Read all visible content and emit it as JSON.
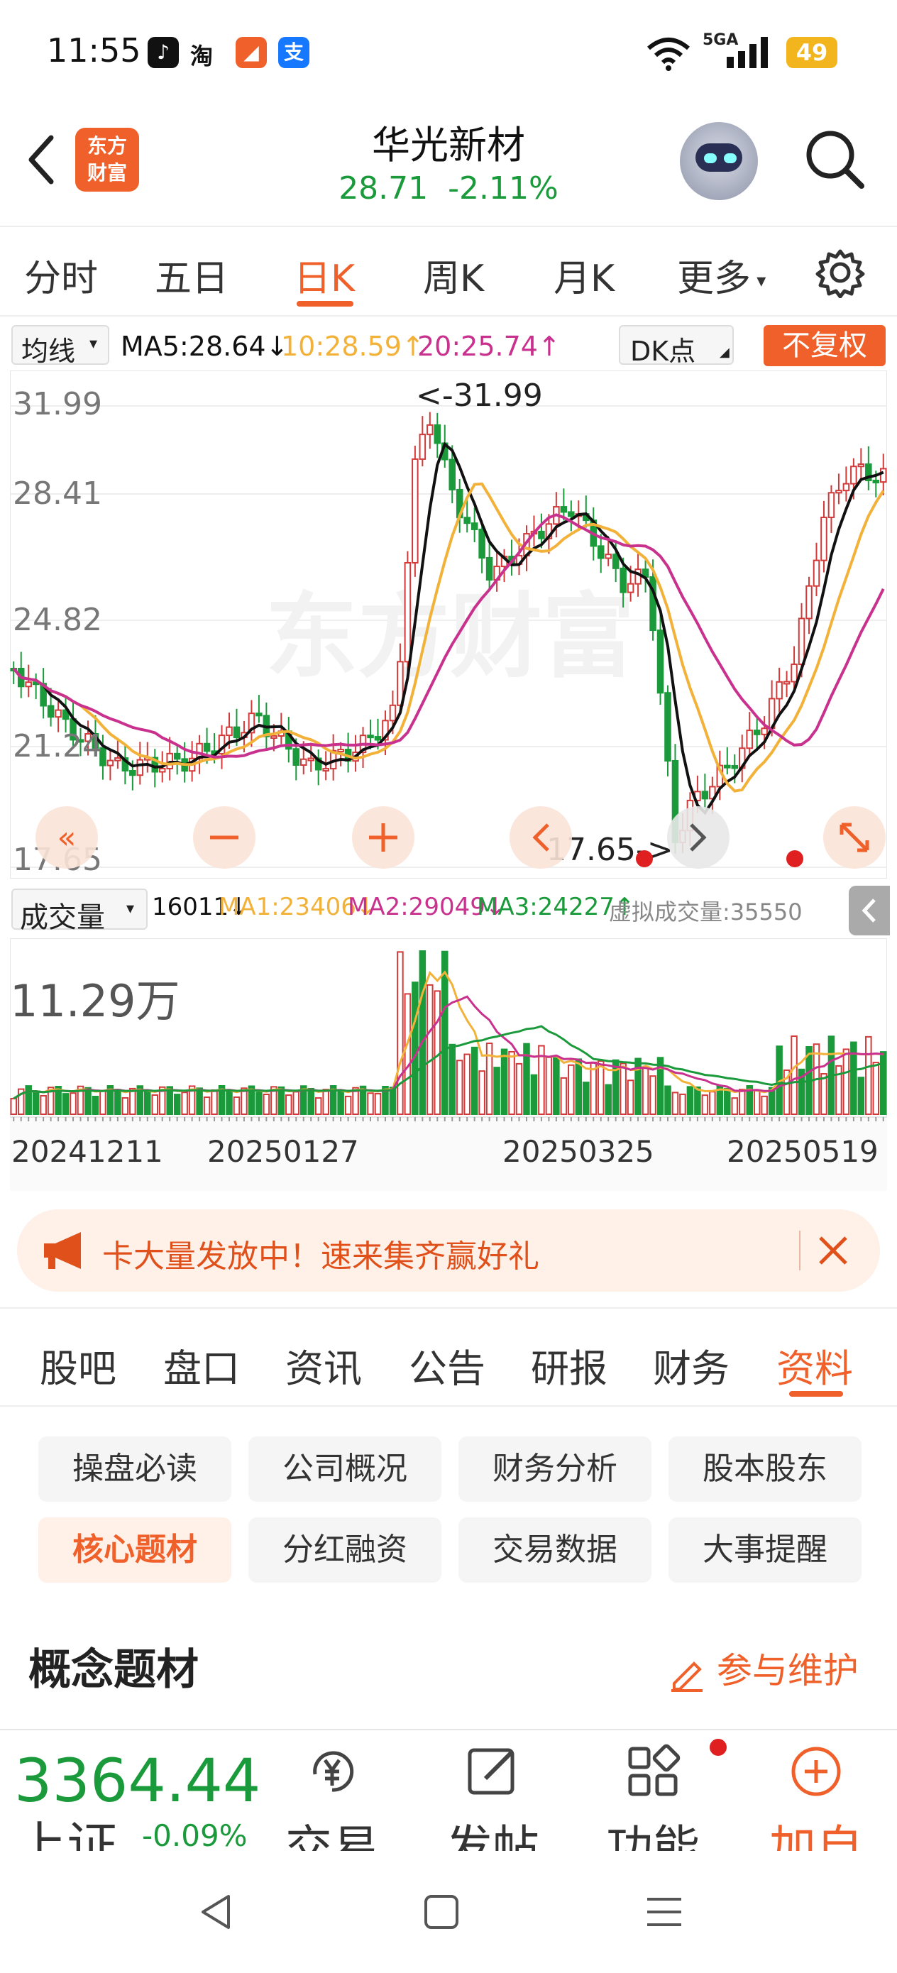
{
  "status_bar": {
    "time": "11:55",
    "battery": "49",
    "network": "5GA",
    "apps": [
      "淘"
    ]
  },
  "header": {
    "logo_text": "东方\n财富",
    "stock_name": "华光新材",
    "price": "28.71",
    "change": "-2.11%"
  },
  "period_tabs": {
    "items": [
      "分时",
      "五日",
      "日K",
      "周K",
      "月K",
      "更多"
    ],
    "active": "日K"
  },
  "ma_line": {
    "selector": "均线",
    "ma5": "MA5:28.64↓",
    "ma10": "10:28.59↑",
    "ma20": "20:25.74↑",
    "dk": "DK点",
    "fuquan": "不复权"
  },
  "colors": {
    "accent": "#f0602a",
    "up": "#d23a3a",
    "down": "#1a9a3a",
    "ma5": "#111111",
    "ma10": "#f2b23a",
    "ma20": "#c8328e"
  },
  "kline": {
    "y_labels": [
      "31.99",
      "28.41",
      "24.82",
      "21.24",
      "17.65"
    ],
    "max_label": "<-31.99",
    "min_label": "17.65->",
    "watermark": "东方财富"
  },
  "volume": {
    "selector": "成交量",
    "value": "16011↓",
    "ma1": "MA1:23406↓",
    "ma2": "MA2:29049↓",
    "ma3": "MA3:24227↑",
    "virtual": "虚拟成交量:35550",
    "max_label": "11.29万"
  },
  "dates": [
    "20241211",
    "20250127",
    "20250325",
    "20250519"
  ],
  "banner": {
    "text": "卡大量发放中！速来集齐赢好礼"
  },
  "sub_tabs": {
    "items": [
      "股吧",
      "盘口",
      "资讯",
      "公告",
      "研报",
      "财务",
      "资料"
    ],
    "active": "资料"
  },
  "info_grid": {
    "items": [
      "操盘必读",
      "公司概况",
      "财务分析",
      "股本股东",
      "核心题材",
      "分红融资",
      "交易数据",
      "大事提醒"
    ],
    "active": "核心题材"
  },
  "section": {
    "title": "概念题材",
    "maintain": "参与维护"
  },
  "bottom_bar": {
    "index_value": "3364.44",
    "index_name": "上证",
    "index_change": "-0.09%",
    "items": [
      "交易",
      "发帖",
      "功能",
      "加自选"
    ]
  }
}
